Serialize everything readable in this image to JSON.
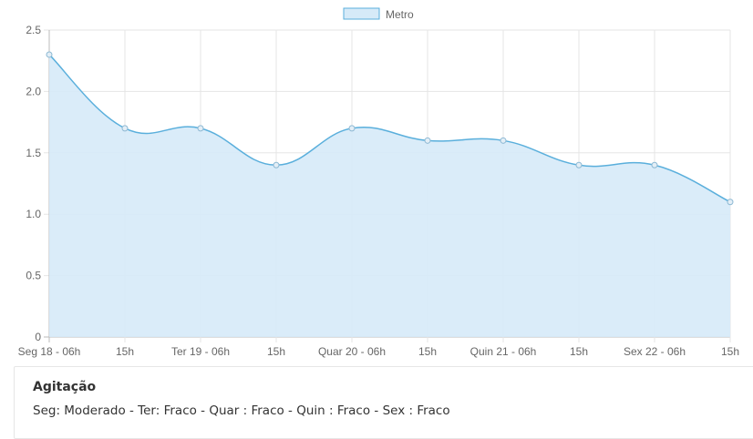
{
  "chart_data": {
    "type": "area",
    "legend_position": "top-center",
    "grid": true,
    "categories": [
      "Seg 18 -  06h",
      "15h",
      "Ter 19 -  06h",
      "15h",
      "Quar 20 -  06h",
      "15h",
      "Quin 21 -  06h",
      "15h",
      "Sex 22 -  06h",
      "15h"
    ],
    "series": [
      {
        "name": "Metro",
        "values": [
          2.3,
          1.7,
          1.7,
          1.4,
          1.7,
          1.6,
          1.6,
          1.4,
          1.4,
          1.1
        ]
      }
    ],
    "yticks": [
      "0",
      "0.5",
      "1.0",
      "1.5",
      "2.0",
      "2.5"
    ],
    "ylim": [
      0,
      2.5
    ],
    "colors": {
      "line": "#5aafdc",
      "fill": "#d6eaf8",
      "grid": "#e5e5e5",
      "axis": "#bbbbbb"
    }
  },
  "info": {
    "title": "Agitação",
    "text": "Seg: Moderado - Ter: Fraco - Quar : Fraco - Quin : Fraco - Sex : Fraco"
  }
}
